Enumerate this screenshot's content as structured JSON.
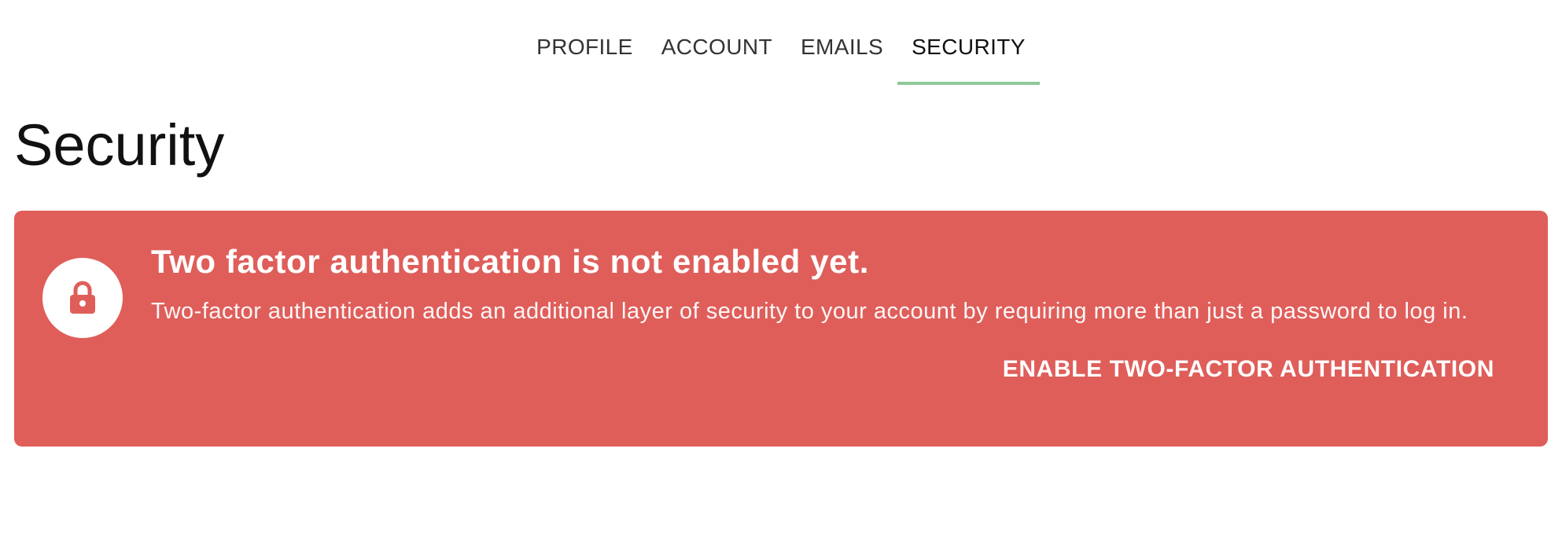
{
  "tabs": [
    {
      "label": "PROFILE"
    },
    {
      "label": "ACCOUNT"
    },
    {
      "label": "EMAILS"
    },
    {
      "label": "SECURITY",
      "active": true
    }
  ],
  "page": {
    "title": "Security"
  },
  "alert": {
    "title": "Two factor authentication is not enabled yet.",
    "description": "Two-factor authentication adds an additional layer of security to your account by requiring more than just a password to log in.",
    "button_label": "ENABLE TWO-FACTOR AUTHENTICATION",
    "icon": "lock-icon"
  },
  "colors": {
    "active_tab_underline": "#8fc99a",
    "alert_background": "#df5e5a",
    "alert_text": "#ffffff"
  }
}
